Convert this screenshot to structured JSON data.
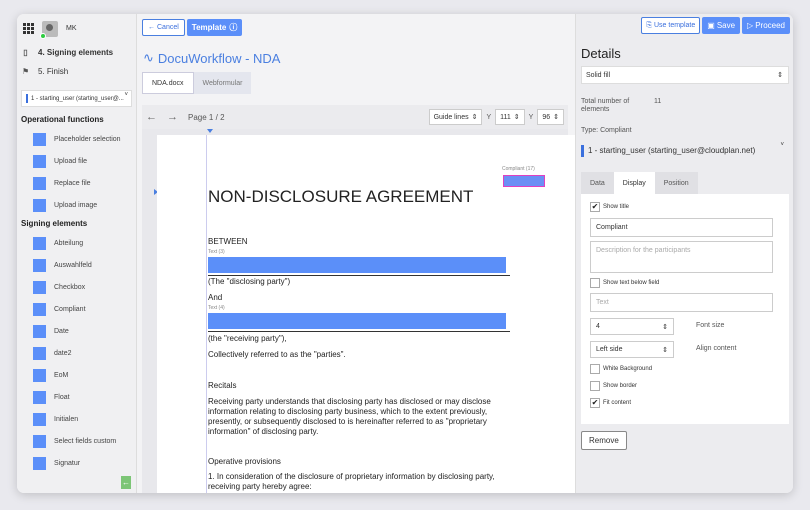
{
  "user": {
    "initials": "MK"
  },
  "steps": [
    {
      "label": "4. Signing elements",
      "icon": "document-icon"
    },
    {
      "label": "5. Finish",
      "icon": "flag-icon"
    }
  ],
  "participant_select": "1 - starting_user (starting_user@...",
  "operational": {
    "title": "Operational functions",
    "items": [
      "Placeholder selection",
      "Upload file",
      "Replace file",
      "Upload image"
    ]
  },
  "signing": {
    "title": "Signing elements",
    "items": [
      "Abteilung",
      "Auswahlfeld",
      "Checkbox",
      "Compliant",
      "Date",
      "date2",
      "EoM",
      "Float",
      "Initialen",
      "Select fields custom",
      "Signatur"
    ]
  },
  "toolbar": {
    "cancel": "Cancel",
    "template": "Template"
  },
  "doc_title": "DocuWorkflow - NDA",
  "tabs": [
    "NDA.docx",
    "Webformular"
  ],
  "pagebar": {
    "page_label": "Page",
    "page_current": "1",
    "page_sep": "/",
    "page_total": "2",
    "guide_lines": "Guide lines",
    "y1_label": "Y",
    "y1_value": "111",
    "y2_label": "Y",
    "y2_value": "96"
  },
  "document": {
    "compliant_label": "Compliant (17)",
    "heading": "NON-DISCLOSURE AGREEMENT",
    "between": "BETWEEN",
    "field1_label": "Text (3)",
    "disclosing": "(The \"disclosing party\")",
    "and": "And",
    "field2_label": "Text (4)",
    "receiving": "(the \"receiving party\"),",
    "collectively": "Collectively referred to as the \"parties\".",
    "recitals": "Recitals",
    "recitals_text": "Receiving party understands that disclosing party has disclosed or may disclose information relating to disclosing party business, which to the extent previously, presently, or subsequently disclosed to is hereinafter referred to as \"proprietary information\" of disclosing party.",
    "operative": "Operative provisions",
    "operative_text": "1. In consideration of the disclosure of proprietary information by disclosing party, receiving party hereby agree:"
  },
  "right": {
    "use_template": "Use template",
    "save": "Save",
    "proceed": "Proceed",
    "details_title": "Details",
    "fill_select": "Solid fill",
    "total_label": "Total number of elements",
    "total_value": "11",
    "type_label": "Type: Compliant",
    "user_select": "1 - starting_user (starting_user@cloudplan.net)",
    "tabs": [
      "Data",
      "Display",
      "Position"
    ],
    "show_title": "Show title",
    "title_value": "Compliant",
    "description_placeholder": "Description for the participants",
    "show_text_below": "Show text below field",
    "text_placeholder": "Text",
    "font_size_value": "4",
    "font_size_label": "Font size",
    "align_value": "Left side",
    "align_label": "Align content",
    "white_bg": "White Background",
    "show_border": "Show border",
    "fit_content": "Fit content",
    "remove": "Remove"
  },
  "colors": {
    "accent": "#5b8ff9",
    "brand": "#3a6fdd"
  }
}
